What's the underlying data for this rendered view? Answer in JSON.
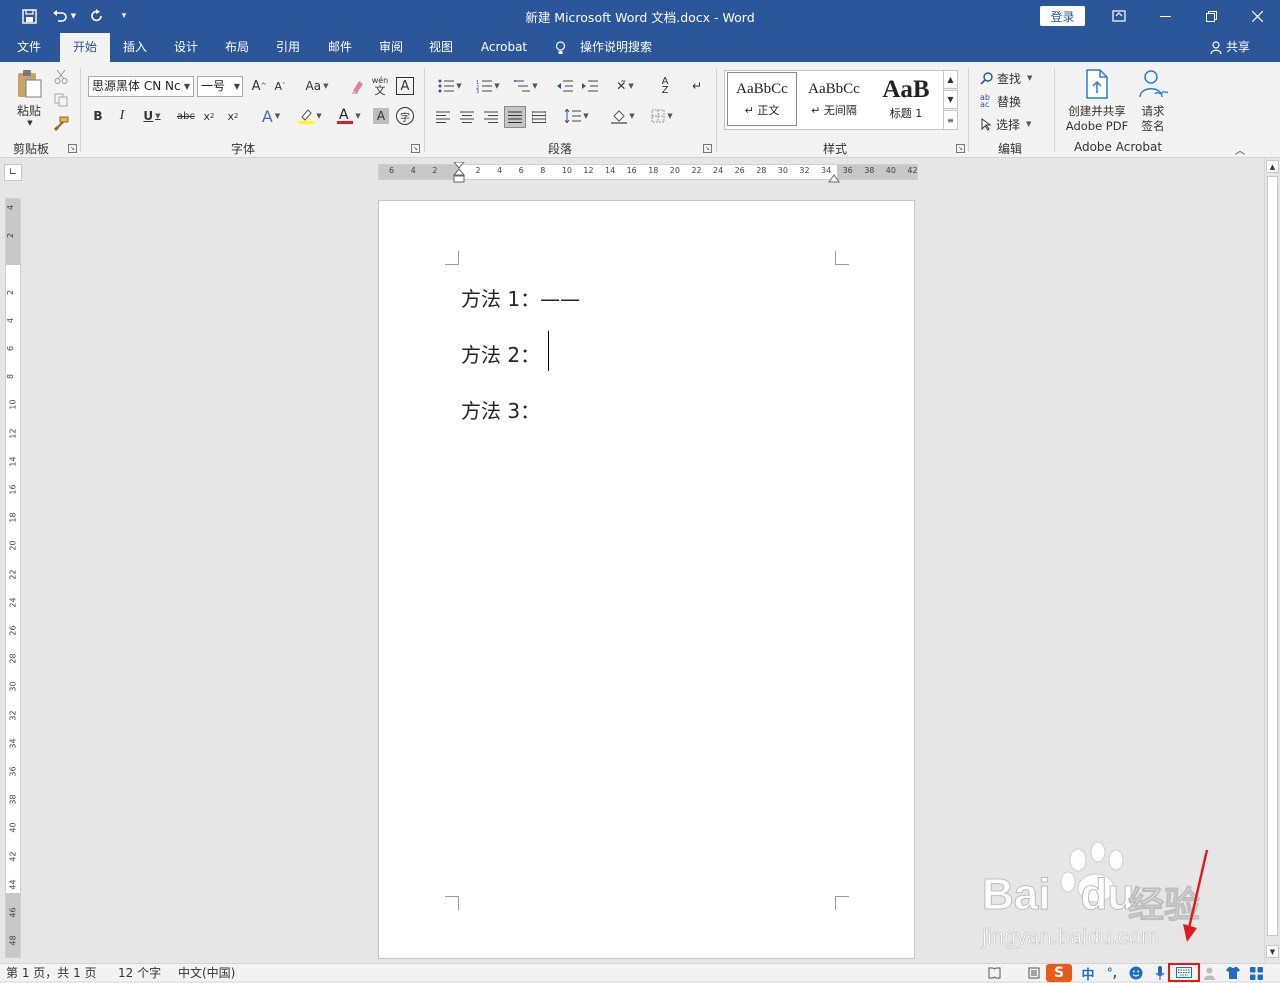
{
  "titlebar": {
    "title": "新建 Microsoft Word 文档.docx  -  Word",
    "login": "登录"
  },
  "tabs": [
    "文件",
    "开始",
    "插入",
    "设计",
    "布局",
    "引用",
    "邮件",
    "审阅",
    "视图",
    "Acrobat"
  ],
  "tell_me": "操作说明搜索",
  "share": "共享",
  "ribbon": {
    "clipboard": {
      "paste": "粘贴",
      "label": "剪贴板"
    },
    "font": {
      "name": "思源黑体 CN Nc",
      "size": "一号",
      "label": "字体",
      "case": "Aa",
      "phonetic": "wén"
    },
    "paragraph": {
      "label": "段落"
    },
    "styles": {
      "label": "样式",
      "items": [
        {
          "preview": "AaBbCc",
          "name": "↵ 正文"
        },
        {
          "preview": "AaBbCc",
          "name": "↵ 无间隔"
        },
        {
          "preview": "AaB",
          "name": "标题 1"
        }
      ]
    },
    "editing": {
      "find": "查找",
      "replace": "替换",
      "select": "选择",
      "label": "编辑"
    },
    "acrobat": {
      "create_line1": "创建并共享",
      "create_line2": "Adobe PDF",
      "sign_line1": "请求",
      "sign_line2": "签名",
      "label": "Adobe Acrobat"
    }
  },
  "ruler_h": [
    "6",
    "4",
    "2",
    "",
    "2",
    "4",
    "6",
    "8",
    "10",
    "12",
    "14",
    "16",
    "18",
    "20",
    "22",
    "24",
    "26",
    "28",
    "30",
    "32",
    "34",
    "36",
    "38",
    "40",
    "42"
  ],
  "ruler_v": [
    "4",
    "2",
    "",
    "2",
    "4",
    "6",
    "8",
    "10",
    "12",
    "14",
    "16",
    "18",
    "20",
    "22",
    "24",
    "26",
    "28",
    "30",
    "32",
    "34",
    "36",
    "38",
    "40",
    "42",
    "44",
    "46",
    "48"
  ],
  "document": {
    "lines": [
      "方法 1：——",
      "方法 2：",
      "方法 3："
    ]
  },
  "statusbar": {
    "page": "第 1 页，共 1 页",
    "words": "12 个字",
    "language": "中文(中国)"
  },
  "ime": {
    "mode": "中",
    "punct": "°,"
  },
  "watermark": {
    "brand": "Bai",
    "brand2": "du",
    "cn": "经验",
    "url": "jingyan.baidu.com"
  },
  "colors": {
    "accent": "#2b579a",
    "highlight_box": "#e0191e",
    "arrow": "#e0191e"
  }
}
